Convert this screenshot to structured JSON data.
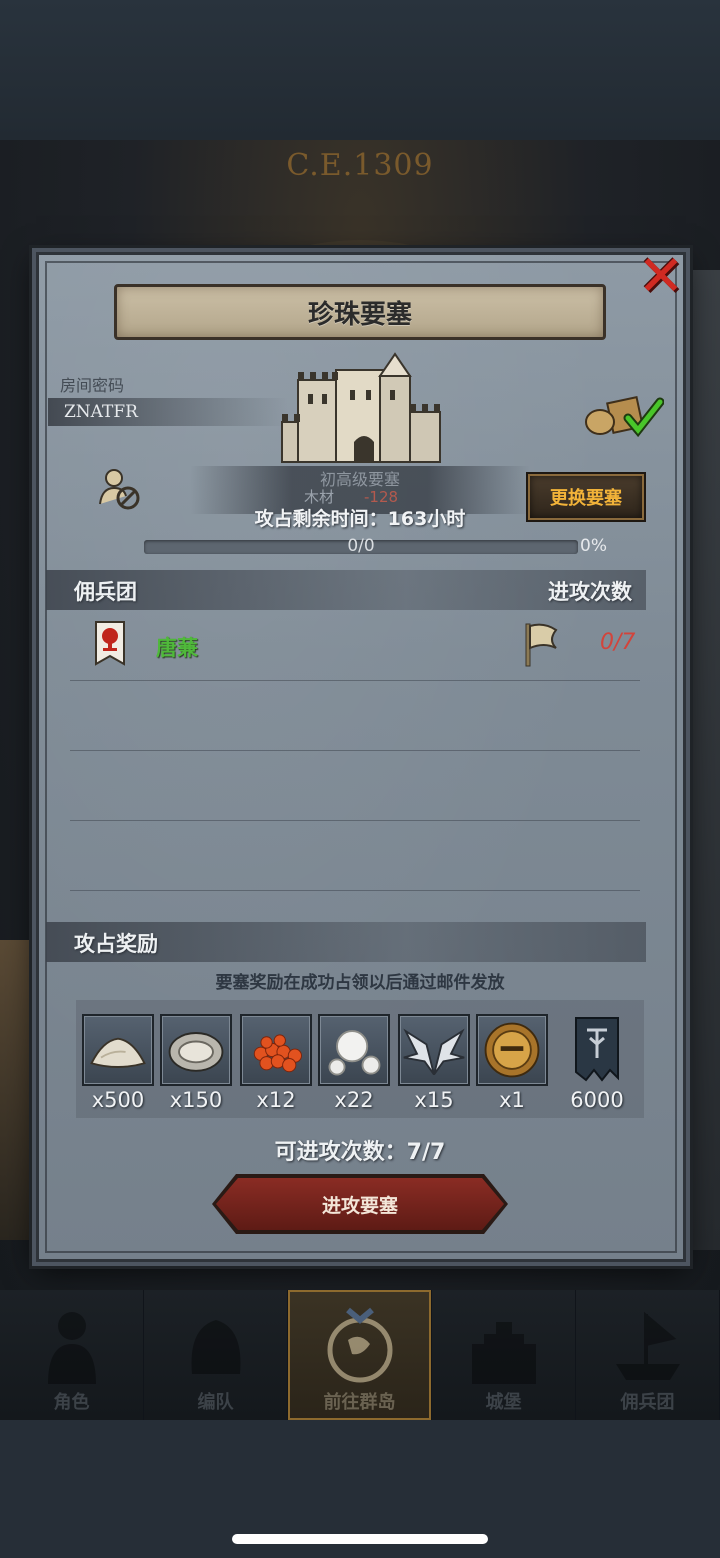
{
  "background": {
    "year": "C.E.1309"
  },
  "modal": {
    "title": "珍珠要塞",
    "room_label": "房间密码",
    "room_code": "ZNATFR",
    "fortress_level": "初高级要塞",
    "wood_label": "木材",
    "wood_value": "-128",
    "attack_time": "攻占剩余时间：163小时",
    "change_button": "更换要塞",
    "progress": {
      "text": "0/0",
      "percent_text": "0%",
      "fraction": 0
    },
    "mercenary_header": "佣兵团",
    "attack_count_header": "进攻次数",
    "mercenaries": [
      {
        "name": "唐蒹",
        "attacks": "0/7"
      }
    ],
    "reward_header": "攻占奖励",
    "reward_note": "要塞奖励在成功占领以后通过邮件发放",
    "rewards": [
      {
        "icon": "salt-pile-icon",
        "qty": "x500"
      },
      {
        "icon": "oyster-icon",
        "qty": "x150"
      },
      {
        "icon": "fish-roe-icon",
        "qty": "x12"
      },
      {
        "icon": "pearl-icon",
        "qty": "x22"
      },
      {
        "icon": "silver-wings-icon",
        "qty": "x15"
      },
      {
        "icon": "golden-helmet-icon",
        "qty": "x1"
      },
      {
        "icon": "honor-banner-icon",
        "qty": "6000"
      }
    ],
    "attacks_available": "可进攻次数：7/7",
    "attack_button": "进攻要塞"
  },
  "nav": [
    {
      "label": "角色",
      "icon": "knight-icon",
      "active": false
    },
    {
      "label": "编队",
      "icon": "helmet-icon",
      "active": false
    },
    {
      "label": "前往群岛",
      "icon": "globe-icon",
      "active": true
    },
    {
      "label": "城堡",
      "icon": "castle-icon",
      "active": false
    },
    {
      "label": "佣兵团",
      "icon": "ship-icon",
      "active": false
    }
  ],
  "colors": {
    "accent_gold": "#f2b339",
    "merc_green": "#4fb93a",
    "count_red": "#d2443b",
    "close_red": "#d02a22"
  }
}
